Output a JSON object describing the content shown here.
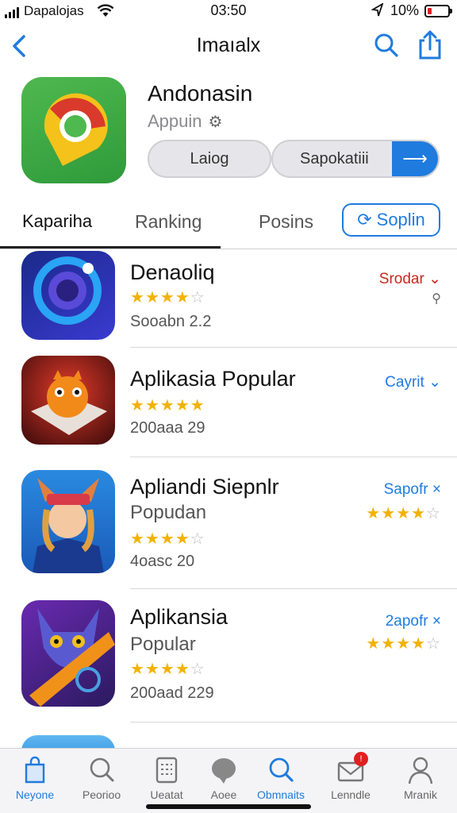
{
  "status_bar": {
    "carrier": "Dapalojas",
    "time": "03:50",
    "battery": "10%"
  },
  "nav": {
    "title": "Imaıalx"
  },
  "app": {
    "name": "Andonasin",
    "subtitle": "Appuin",
    "button_left": "Laiog",
    "button_right": "Sapokatiii",
    "arrow": "⟶"
  },
  "tabs": {
    "items": [
      "Kapariha",
      "Ranking",
      "Posins"
    ],
    "active_index": 0,
    "action_label": "Soplin"
  },
  "list": [
    {
      "name": "Denaoliq",
      "subtitle": "",
      "stars": 4,
      "meta": "Sooabn 2.2",
      "action": "Srodar",
      "action_color": "#c8281e",
      "action_icon": "chevron-down",
      "extra": "⚲",
      "action_stars": 0
    },
    {
      "name": "Aplikasia Popular",
      "subtitle": "",
      "stars": 4.5,
      "meta": "200aaa 29",
      "action": "Cayrit",
      "action_color": "#1f7bde",
      "action_icon": "chevron-down",
      "extra": "",
      "action_stars": 0
    },
    {
      "name": "Apliandi Siepnlr",
      "subtitle": "Popudan",
      "stars": 3.5,
      "meta": "4oasc 20",
      "action": "Sapofr",
      "action_color": "#1f7bde",
      "action_icon": "close",
      "extra": "",
      "action_stars": 4
    },
    {
      "name": "Aplikansia",
      "subtitle": "Popular",
      "stars": 4,
      "meta": "200aad 229",
      "action": "2apofr",
      "action_color": "#1f7bde",
      "action_icon": "close",
      "extra": "",
      "action_stars": 4
    }
  ],
  "tab_bar": [
    {
      "label": "Neyone",
      "icon": "bag-icon",
      "active": true
    },
    {
      "label": "Peorioo",
      "icon": "search-icon",
      "active": false
    },
    {
      "label": "Ueatat",
      "icon": "calculator-icon",
      "active": false
    },
    {
      "label": "Aoee",
      "icon": "chat-icon",
      "active": false
    },
    {
      "label": "Obmnaits",
      "icon": "search-icon",
      "active": true
    },
    {
      "label": "Lenndle",
      "icon": "mail-icon",
      "active": false,
      "badge": "!"
    },
    {
      "label": "Mranik",
      "icon": "person-icon",
      "active": false
    }
  ]
}
